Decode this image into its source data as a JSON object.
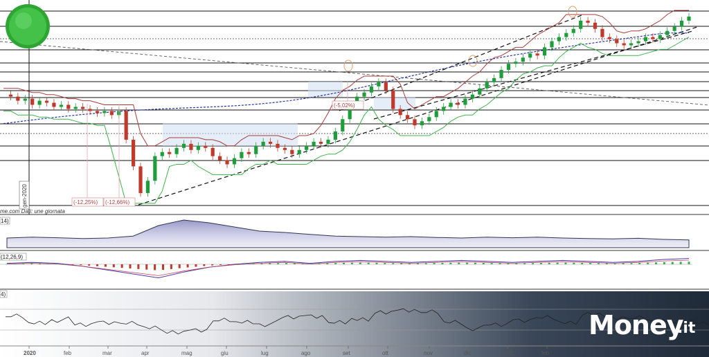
{
  "chart_data": {
    "type": "candlestick",
    "title": "",
    "xlabel": "",
    "ylabel": "",
    "x_tick_labels": [
      "2020",
      "feb",
      "mar",
      "apr",
      "mag",
      "giu",
      "lug",
      "ago",
      "set",
      "ott",
      "nov",
      "dic",
      "2021",
      "feb"
    ],
    "vertical_date_label": "gen-2020",
    "source_text": "me.com  Dati: une giornata",
    "percent_annotations": [
      "(-12,25%)",
      "(-12,66%)",
      "(-5,02%)"
    ],
    "indicator_labels": [
      "14)",
      "(12,26,9)",
      "4)"
    ],
    "price_series": [
      60,
      59,
      57,
      58,
      55,
      57,
      56,
      54,
      55,
      53,
      54,
      53,
      52,
      51,
      52,
      50,
      52,
      38,
      25,
      12,
      18,
      30,
      32,
      31,
      34,
      36,
      33,
      35,
      34,
      30,
      28,
      26,
      29,
      32,
      31,
      35,
      37,
      36,
      34,
      33,
      31,
      33,
      35,
      37,
      36,
      38,
      42,
      48,
      55,
      59,
      61,
      64,
      66,
      62,
      53,
      50,
      48,
      45,
      47,
      49,
      52,
      54,
      56,
      55,
      58,
      60,
      63,
      66,
      68,
      72,
      75,
      76,
      78,
      80,
      79,
      83,
      86,
      88,
      90,
      92,
      96,
      95,
      92,
      88,
      87,
      85,
      84,
      85,
      86,
      88,
      87,
      89,
      91,
      93,
      96,
      98
    ],
    "macd_line": [
      0.1,
      0.2,
      0.1,
      -0.2,
      -0.6,
      -1.0,
      -1.4,
      -0.8,
      -0.3,
      0.0,
      0.2,
      0.3,
      0.1,
      0.3,
      0.4,
      0.3,
      0.2,
      0.3,
      0.4,
      0.3,
      0.2,
      0.3,
      0.4,
      0.3,
      0.2,
      0.3,
      0.5,
      0.6
    ],
    "volatility_series": [
      0.35,
      0.38,
      0.36,
      0.33,
      0.35,
      0.42,
      0.8,
      1.0,
      0.9,
      0.75,
      0.6,
      0.55,
      0.48,
      0.42,
      0.4,
      0.38,
      0.4,
      0.37,
      0.35,
      0.38,
      0.36,
      0.38,
      0.35,
      0.33,
      0.32,
      0.34,
      0.3,
      0.28
    ],
    "oscillator_series": [
      0.62,
      0.48,
      0.55,
      0.42,
      0.5,
      0.46,
      0.38,
      0.22,
      0.3,
      0.52,
      0.5,
      0.45,
      0.6,
      0.65,
      0.48,
      0.58,
      0.7,
      0.78,
      0.72,
      0.5,
      0.35,
      0.42,
      0.55,
      0.6,
      0.5,
      0.66,
      0.6,
      0.58,
      0.52,
      0.48,
      0.45
    ]
  },
  "brand": {
    "name": "Money",
    "suffix": ".it",
    "green": "#3dbb3d",
    "dark": "#1f2a38"
  },
  "colors": {
    "up": "#1f9d3a",
    "down": "#c0392b",
    "trend": "#222222",
    "ma": "#2233aa",
    "upper_band": "#a83a3a",
    "lower_band": "#3cb34a"
  }
}
